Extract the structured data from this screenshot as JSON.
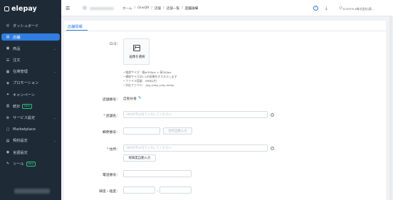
{
  "brand": {
    "name": "elepay"
  },
  "sidebar": {
    "items": [
      {
        "label": "ダッシュボード",
        "icon": "dashboard-icon",
        "glyph": "◎",
        "chevron": false,
        "badge": ""
      },
      {
        "label": "店舗",
        "icon": "store-icon",
        "glyph": "▤",
        "chevron": false,
        "badge": "",
        "active": true
      },
      {
        "label": "商品",
        "icon": "product-icon",
        "glyph": "▣",
        "chevron": true,
        "badge": ""
      },
      {
        "label": "注文",
        "icon": "order-icon",
        "glyph": "☰",
        "chevron": false,
        "badge": ""
      },
      {
        "label": "在庫管理",
        "icon": "inventory-icon",
        "glyph": "▦",
        "chevron": true,
        "badge": ""
      },
      {
        "label": "プロモーション",
        "icon": "promotion-icon",
        "glyph": "◈",
        "chevron": false,
        "badge": ""
      },
      {
        "label": "キャンペーン",
        "icon": "campaign-icon",
        "glyph": "✦",
        "chevron": false,
        "badge": ""
      },
      {
        "label": "統計",
        "icon": "stats-icon",
        "glyph": "▥",
        "chevron": false,
        "badge": "New"
      },
      {
        "label": "サービス設定",
        "icon": "service-settings-icon",
        "glyph": "⚙",
        "chevron": true,
        "badge": ""
      },
      {
        "label": "Marketplace",
        "icon": "marketplace-icon",
        "glyph": "▢",
        "chevron": false,
        "badge": ""
      },
      {
        "label": "契約設定",
        "icon": "contract-icon",
        "glyph": "▤",
        "chevron": true,
        "badge": ""
      },
      {
        "label": "言語設定",
        "icon": "language-icon",
        "glyph": "◉",
        "chevron": false,
        "badge": ""
      },
      {
        "label": "ツール",
        "icon": "tool-icon",
        "glyph": "✎",
        "chevron": false,
        "badge": "New"
      }
    ]
  },
  "header": {
    "breadcrumb": [
      "ホーム",
      "OneQR",
      "店舗",
      "店舗一覧",
      "店舗詳細"
    ],
    "user_name": "ELESTYLE株式会社(東..."
  },
  "tabs": {
    "active": "店舗情報"
  },
  "form": {
    "logo_label": "ロゴ",
    "select_image": "画像を選択",
    "notes": [
      "推奨サイズ：幅≥300px × 高300px",
      "横縦サイズは1:1の画像をオススメします",
      "ファイル容量：5MB以内",
      "対応ファイル：.jpg,.jpeg,.png,.webp"
    ],
    "store_number_label": "店舗番号",
    "store_number_value": "自動採番",
    "store_name_label": "店舗名",
    "store_name_placeholder": "300文字以内で入力してください",
    "postal_label": "郵便番号",
    "postal_button": "住所自動入力",
    "address_label": "住所",
    "address_placeholder": "300文字以内で入力してください",
    "latlng_button": "経緯度自動入力",
    "phone_label": "電話番号",
    "latlng_label": "緯度・経度",
    "latlng_separator": "-"
  }
}
